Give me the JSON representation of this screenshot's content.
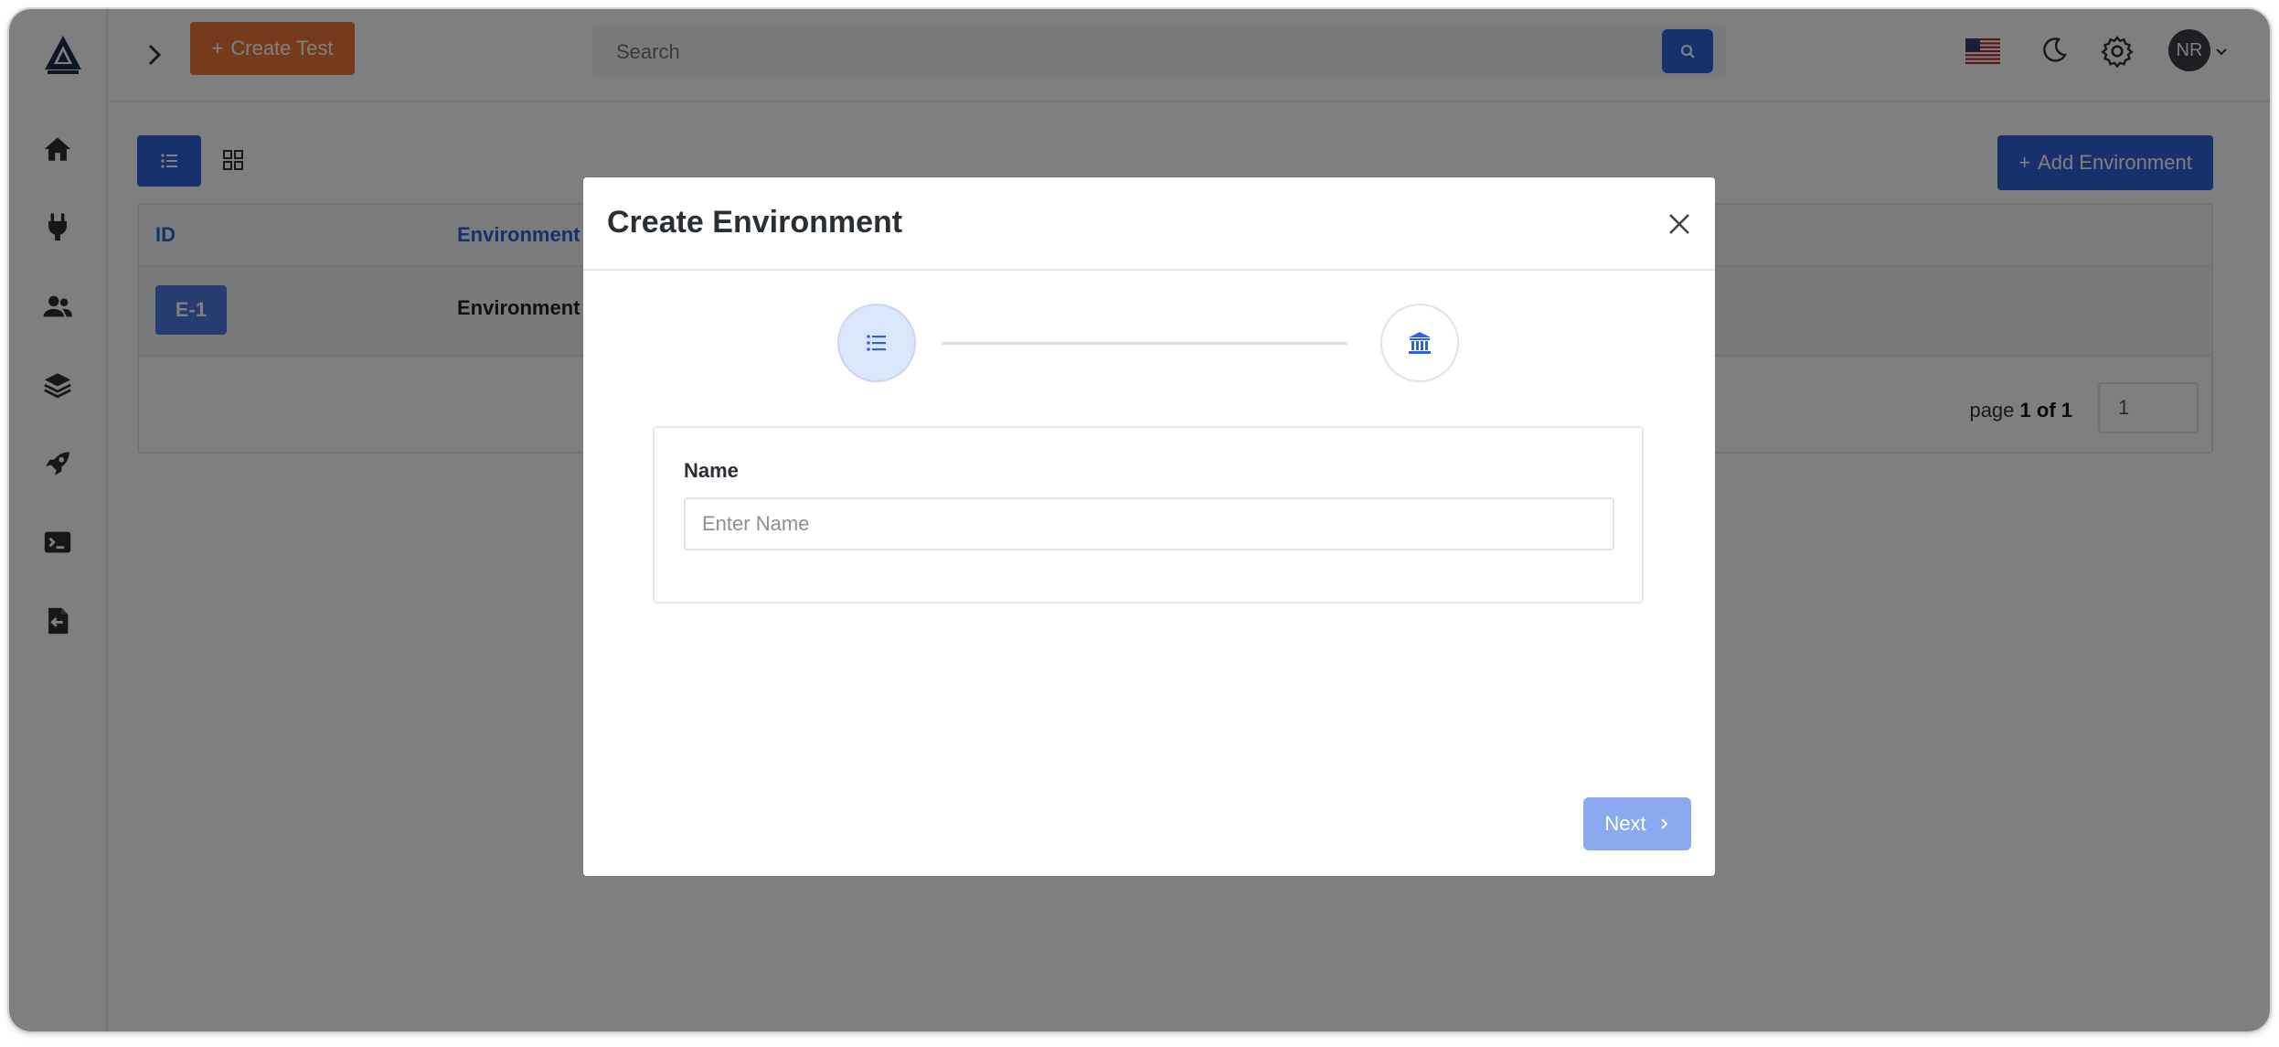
{
  "header": {
    "create_test_label": "Create Test",
    "search_placeholder": "Search",
    "avatar_initials": "NR"
  },
  "toolbar": {
    "add_environment_label": "Add Environment"
  },
  "table": {
    "columns": [
      "ID",
      "Environment"
    ],
    "rows": [
      {
        "id": "E-1",
        "environment": "Environment"
      }
    ],
    "pager_prefix": "page",
    "pager_current": "1 of 1",
    "page_input_value": "1"
  },
  "modal": {
    "title": "Create Environment",
    "name_label": "Name",
    "name_placeholder": "Enter Name",
    "next_label": "Next"
  },
  "icons": {
    "sidebar": [
      "home-icon",
      "plug-icon",
      "users-icon",
      "layers-icon",
      "rocket-icon",
      "terminal-icon",
      "file-import-icon"
    ],
    "step1": "list-icon",
    "step2": "bank-icon"
  },
  "colors": {
    "primary": "#2d62d8",
    "create_test": "#e8793a",
    "next_disabled": "#8aa9ee"
  }
}
